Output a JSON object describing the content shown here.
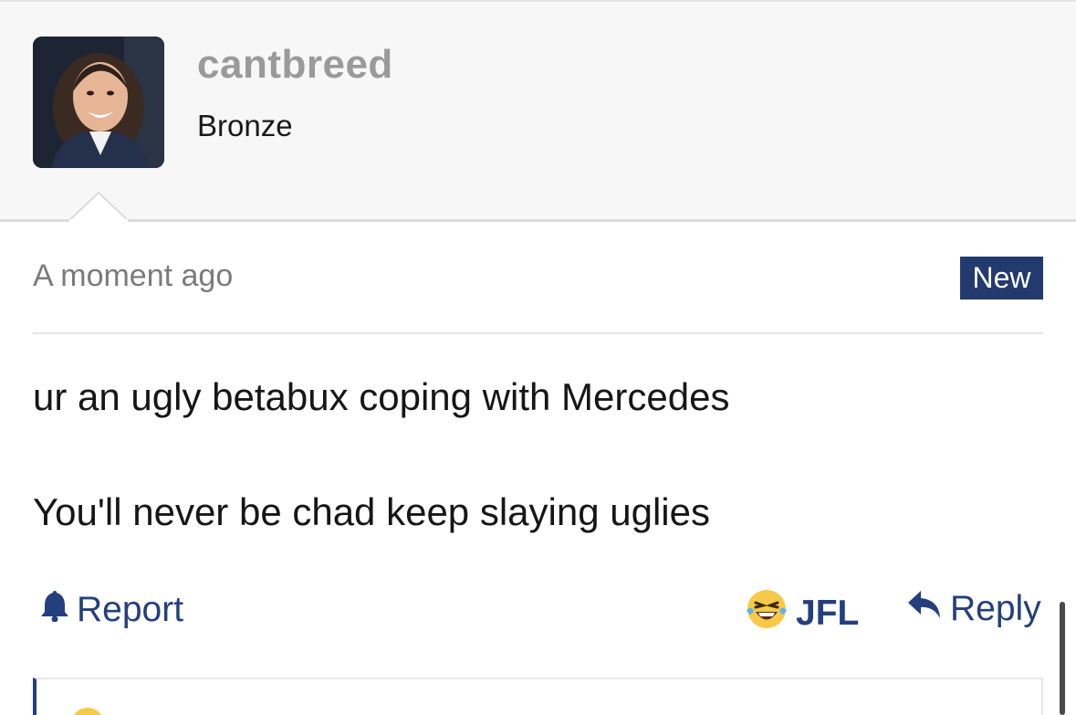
{
  "post": {
    "username": "cantbreed",
    "rank": "Bronze",
    "timestamp": "A moment ago",
    "badge": "New",
    "message_lines": [
      "ur an ugly betabux coping with Mercedes",
      "You'll never be chad keep slaying uglies"
    ]
  },
  "actions": {
    "report_label": "Report",
    "report_icon": "bell-icon",
    "reaction_label": "JFL",
    "reaction_icon": "laughing-crying-emoji-icon",
    "reply_label": "Reply",
    "reply_icon": "reply-arrow-icon"
  },
  "colors": {
    "accent": "#233a6e",
    "link": "#243f7d",
    "username": "#9a9a9a",
    "header_bg": "#f7f7f7"
  }
}
